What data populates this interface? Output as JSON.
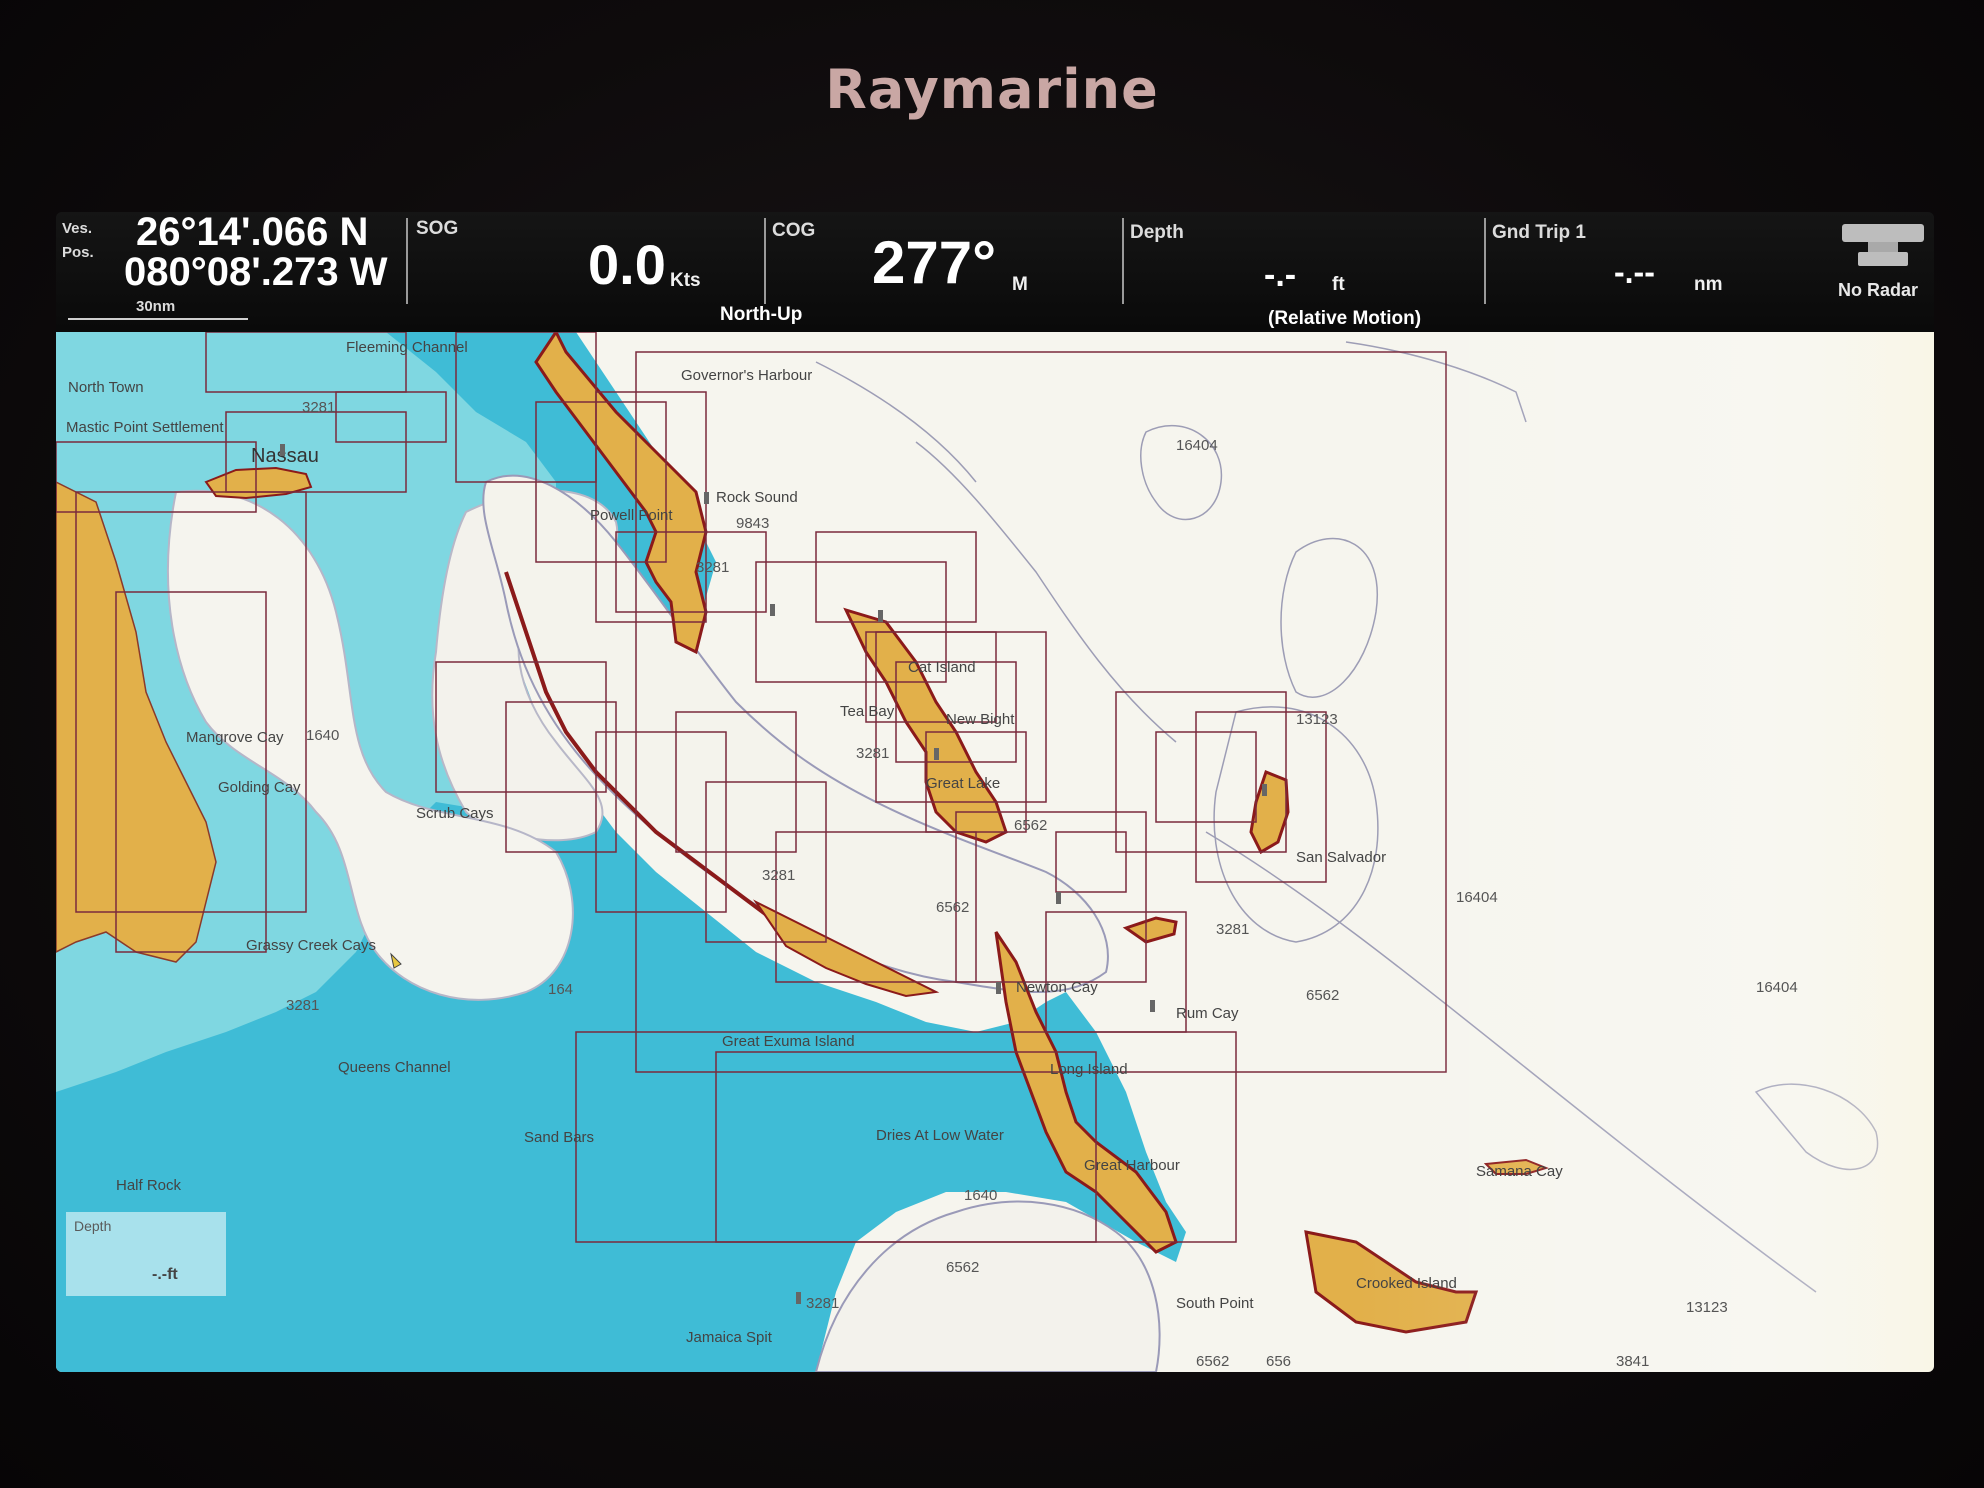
{
  "device": {
    "brand": "Raymarine"
  },
  "databar": {
    "position": {
      "caption_top": "Ves.",
      "caption_bottom": "Pos.",
      "lat": "26°14'.066 N",
      "lon": "080°08'.273 W"
    },
    "sog": {
      "caption": "SOG",
      "value": "0.0",
      "unit": "Kts"
    },
    "cog": {
      "caption": "COG",
      "value": "277°",
      "unit": "M"
    },
    "depth": {
      "caption": "Depth",
      "value": "-.-",
      "unit": "ft"
    },
    "trip": {
      "caption": "Gnd Trip 1",
      "value": "-.--",
      "unit": "nm"
    },
    "radar": {
      "label": "No Radar",
      "icon": "radar-antenna-icon"
    },
    "orientation": "North-Up",
    "motion_mode": "(Relative Motion)",
    "scale": "30nm"
  },
  "chart": {
    "place_labels": {
      "fleeming": "Fleeming Channel",
      "north_town": "North Town",
      "mastic_point": "Mastic Point Settlement",
      "nassau": "Nassau",
      "governors": "Governor's Harbour",
      "rock_sound": "Rock Sound",
      "powell": "Powell Point",
      "cat_island": "Cat Island",
      "tea_bay": "Tea Bay",
      "new_bight": "New Bight",
      "great_lake": "Great Lake",
      "mangrove": "Mangrove Cay",
      "golding": "Golding Cay",
      "scrub": "Scrub Cays",
      "grassy": "Grassy Creek Cays",
      "queens": "Queens Channel",
      "sand_bars": "Sand Bars",
      "half_rock": "Half Rock",
      "great_exuma": "Great Exuma Island",
      "newton": "Newton Cay",
      "rum_cay": "Rum Cay",
      "long_island": "Long Island",
      "dries": "Dries At Low Water",
      "great_harbour": "Great Harbour",
      "south_point": "South Point",
      "jamaica_spit": "Jamaica Spit",
      "salvador": "San Salvador",
      "samana": "Samana Cay",
      "crooked": "Crooked Island"
    },
    "soundings": {
      "s16404a": "16404",
      "s16404b": "16404",
      "s16404c": "16404",
      "s13123a": "13123",
      "s13123b": "13123",
      "s9843": "9843",
      "s3281a": "3281",
      "s3281b": "3281",
      "s3281c": "3281",
      "s3281d": "3281",
      "s3281e": "3281",
      "s3281f": "3281",
      "s3281g": "3281",
      "s1640a": "1640",
      "s1640b": "1640",
      "s164": "164",
      "s6562a": "6562",
      "s6562b": "6562",
      "s6562c": "6562",
      "s6562d": "6562",
      "s6562e": "6562",
      "s656": "656",
      "s3841": "3841"
    },
    "depth_box": {
      "caption": "Depth",
      "value": "-.-ft"
    }
  },
  "colors": {
    "land": "#e6b44c",
    "deep_water": "#f7f4e6",
    "shoal": "#4cc4dc",
    "shallow": "#8ee0e6",
    "chart_bounds": "#7a2a3c",
    "coast": "#8b1a1a"
  }
}
